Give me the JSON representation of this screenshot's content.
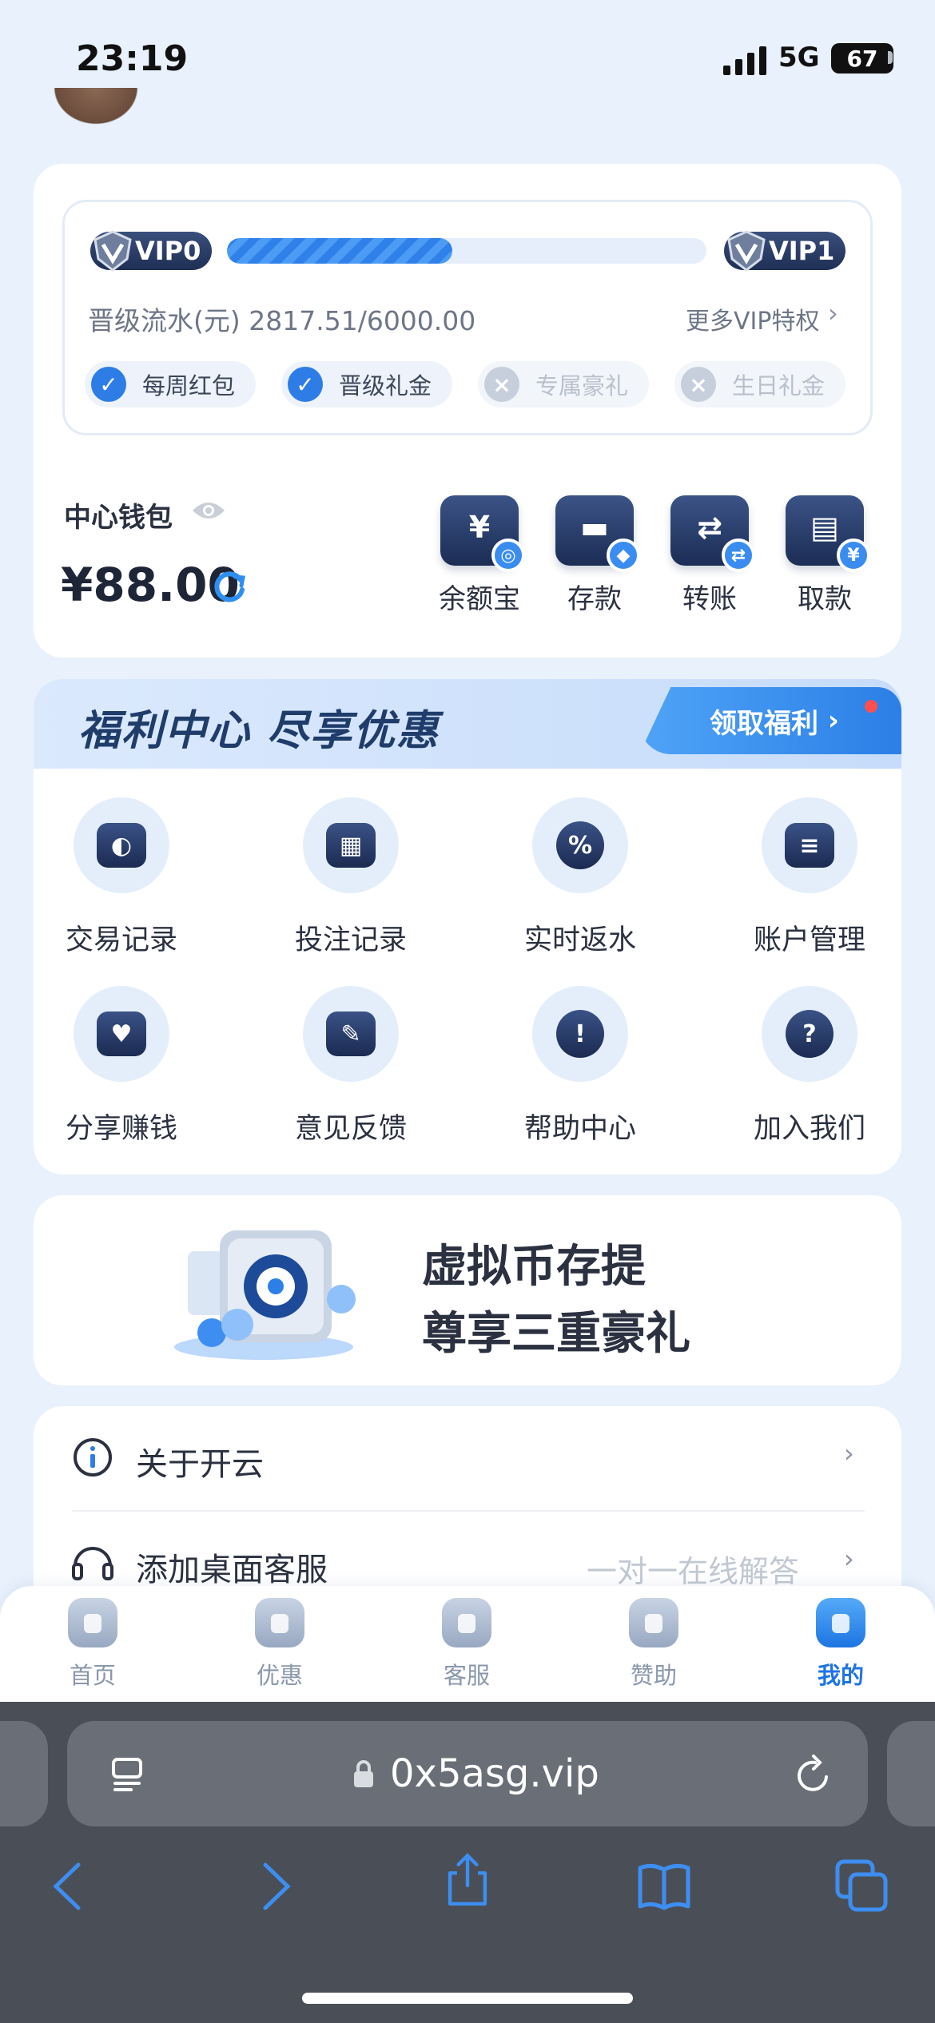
{
  "status_bar": {
    "time": "23:19",
    "network": "5G",
    "battery": "67"
  },
  "vip": {
    "current_level": "VIP0",
    "next_level": "VIP1",
    "progress_fraction": 0.47,
    "progress_text": "晋级流水(元) 2817.51/6000.00",
    "more_link": "更多VIP特权",
    "perks": [
      {
        "label": "每周红包",
        "enabled": true
      },
      {
        "label": "晋级礼金",
        "enabled": true
      },
      {
        "label": "专属豪礼",
        "enabled": false
      },
      {
        "label": "生日礼金",
        "enabled": false
      }
    ]
  },
  "wallet": {
    "label": "中心钱包",
    "amount": "¥88.00",
    "actions": [
      {
        "label": "余额宝",
        "glyph": "¥",
        "icon": "yuebao-icon"
      },
      {
        "label": "存款",
        "glyph": "▬",
        "icon": "deposit-icon"
      },
      {
        "label": "转账",
        "glyph": "⇄",
        "icon": "transfer-icon"
      },
      {
        "label": "取款",
        "glyph": "▤",
        "icon": "withdraw-icon"
      }
    ]
  },
  "welfare": {
    "title": "福利中心 尽享优惠",
    "button": "领取福利",
    "items": [
      {
        "label": "交易记录",
        "icon": "wallet-icon",
        "glyph": "◐"
      },
      {
        "label": "投注记录",
        "icon": "calendar-icon",
        "glyph": "▦"
      },
      {
        "label": "实时返水",
        "icon": "percent-badge-icon",
        "glyph": "%"
      },
      {
        "label": "账户管理",
        "icon": "id-card-icon",
        "glyph": "≡"
      },
      {
        "label": "分享赚钱",
        "icon": "handshake-icon",
        "glyph": "♥"
      },
      {
        "label": "意见反馈",
        "icon": "edit-note-icon",
        "glyph": "✎"
      },
      {
        "label": "帮助中心",
        "icon": "alert-icon",
        "glyph": "!"
      },
      {
        "label": "加入我们",
        "icon": "question-icon",
        "glyph": "?"
      }
    ]
  },
  "banner": {
    "line1": "虚拟币存提",
    "line2": "尊享三重豪礼"
  },
  "list": [
    {
      "label": "关于开云",
      "hint": ""
    },
    {
      "label": "添加桌面客服",
      "hint": "一对一在线解答"
    }
  ],
  "tabs": [
    {
      "label": "首页",
      "active": false
    },
    {
      "label": "优惠",
      "active": false
    },
    {
      "label": "客服",
      "active": false
    },
    {
      "label": "赞助",
      "active": false
    },
    {
      "label": "我的",
      "active": true
    }
  ],
  "browser": {
    "url": "0x5asg.vip"
  },
  "colors": {
    "accent": "#2e7de6",
    "navy": "#1f2f55",
    "background": "#e8f1fc"
  }
}
